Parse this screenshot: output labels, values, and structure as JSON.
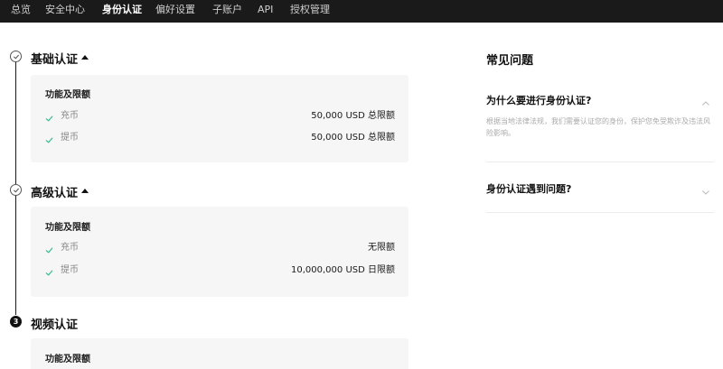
{
  "nav": {
    "items": [
      {
        "label": "总览",
        "active": false
      },
      {
        "label": "安全中心",
        "active": false
      },
      {
        "label": "身份认证",
        "active": true
      },
      {
        "label": "偏好设置",
        "active": false
      },
      {
        "label": "子账户",
        "active": false
      },
      {
        "label": "API",
        "active": false
      },
      {
        "label": "授权管理",
        "active": false
      }
    ]
  },
  "steps": [
    {
      "title": "基础认证",
      "status": "completed",
      "card_heading": "功能及限额",
      "rows": [
        {
          "label": "充币",
          "value": "50,000 USD 总限额"
        },
        {
          "label": "提币",
          "value": "50,000 USD 总限额"
        }
      ]
    },
    {
      "title": "高级认证",
      "status": "completed",
      "card_heading": "功能及限额",
      "rows": [
        {
          "label": "充币",
          "value": "无限额"
        },
        {
          "label": "提币",
          "value": "10,000,000 USD 日限额"
        }
      ]
    },
    {
      "title": "视频认证",
      "status": "pending",
      "number": "3",
      "card_heading": "功能及限额"
    }
  ],
  "faq": {
    "title": "常见问题",
    "items": [
      {
        "question": "为什么要进行身份认证?",
        "expanded": true,
        "answer": "根据当地法律法规，我们需要认证您的身份，保护您免受欺诈及违法风险影响。"
      },
      {
        "question": "身份认证遇到问题?",
        "expanded": false
      }
    ]
  },
  "colors": {
    "nav_bg": "#1a1a1a",
    "check_green": "#2ebd85",
    "card_bg": "#f6f6f6"
  },
  "icons": {
    "completed": "check-circle-icon",
    "collapse": "caret-up-icon",
    "row_check": "check-icon",
    "faq_expanded": "chevron-up-icon",
    "faq_collapsed": "chevron-down-icon"
  }
}
